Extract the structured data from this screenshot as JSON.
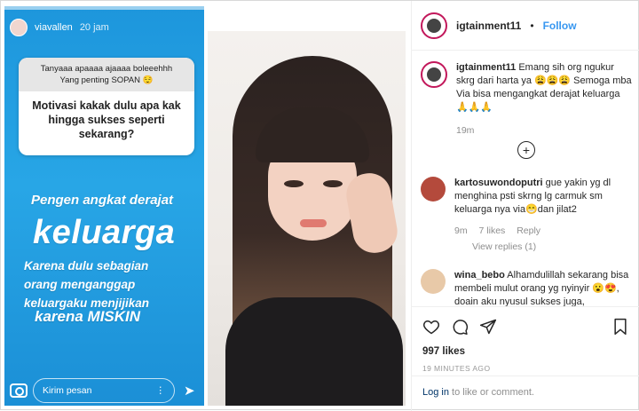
{
  "story": {
    "username": "viavallen",
    "time": "20 jam",
    "question_header_line1": "Tanyaaa apaaaa ajaaaa boleeehhh",
    "question_header_line2": "Yang penting SOPAN 😌",
    "question": "Motivasi kakak dulu apa kak hingga sukses seperti sekarang?",
    "answer_line1": "Pengen angkat derajat",
    "answer_big": "keluarga",
    "answer_line3": "Karena dulu sebagian",
    "answer_line4": "orang menganggap",
    "answer_line5": "keluargaku menjijikan",
    "answer_line6": "karena MISKIN",
    "message_placeholder": "Kirim pesan",
    "more_glyph": "⋮",
    "send_glyph": "➤"
  },
  "post": {
    "account": "igtainment11",
    "dot": "•",
    "follow_label": "Follow",
    "caption_user": "igtainment11",
    "caption_text": "Emang sih org ngukur skrg dari harta ya 😩😩😩 Semoga mba Via bisa mengangkat derajat keluarga 🙏🙏🙏",
    "caption_time": "19m",
    "load_more": "+",
    "comments": [
      {
        "user": "kartosuwondoputri",
        "text": "gue yakin yg dl menghina psti skrng lg carmuk sm keluarga nya via😁dan jilat2",
        "time": "9m",
        "likes": "7 likes",
        "reply": "Reply",
        "view_replies": "View replies (1)"
      },
      {
        "user": "wina_bebo",
        "text": "Alhamdulillah sekarang bisa membeli mulut orang yg nyinyir 😮😍, doain aku nyusul sukses juga,"
      }
    ],
    "likes": "997 likes",
    "posted_ago": "19 MINUTES AGO",
    "login_link": "Log in",
    "login_rest": " to like or comment."
  },
  "colors": {
    "story_blue": "#1d96dc",
    "follow_blue": "#3897f0",
    "link_dark": "#003569"
  }
}
